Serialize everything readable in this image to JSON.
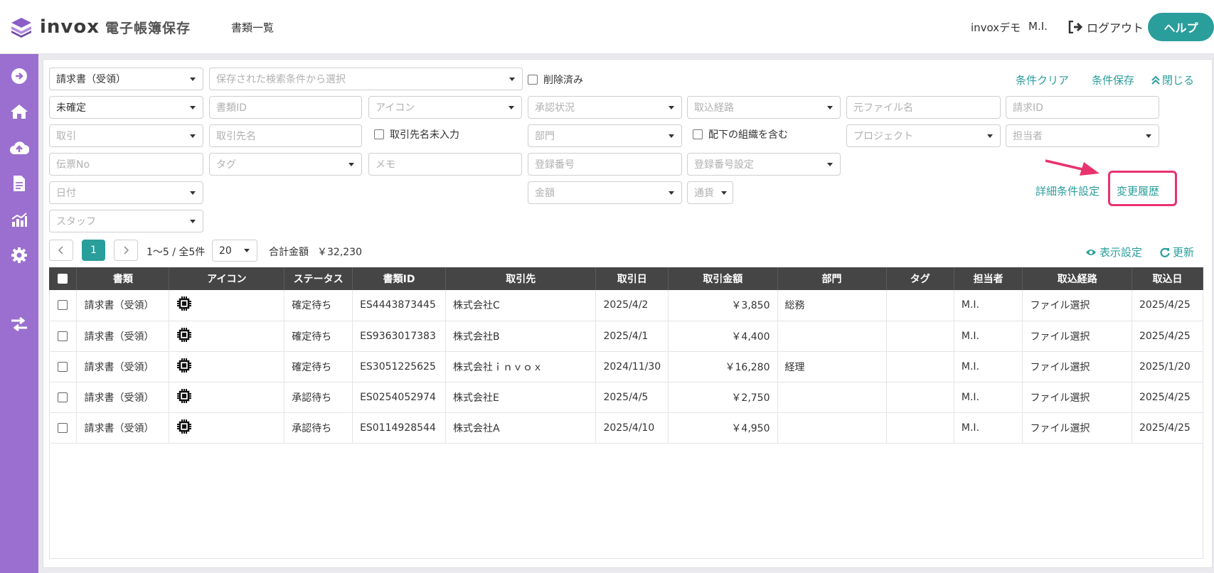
{
  "header": {
    "logo_text": "invox",
    "logo_sub": "電子帳簿保存",
    "nav_docs": "書類一覧",
    "org": "invoxデモ",
    "user": "M.I.",
    "logout": "ログアウト",
    "help": "ヘルプ"
  },
  "filters": {
    "doc_type": "請求書（受領）",
    "saved_search": "保存された検索条件から選択",
    "deleted": "削除済み",
    "clear": "条件クリア",
    "save": "条件保存",
    "close": "閉じる",
    "confirm_status": "未確定",
    "doc_id": "書類ID",
    "icon": "アイコン",
    "approval": "承認状況",
    "route": "取込経路",
    "filename": "元ファイル名",
    "invoice_id": "請求ID",
    "deal": "取引",
    "partner": "取引先名",
    "partner_blank": "取引先名未入力",
    "department": "部門",
    "include_sub": "配下の組織を含む",
    "project": "プロジェクト",
    "assignee": "担当者",
    "slip_no": "伝票No",
    "tag": "タグ",
    "memo": "メモ",
    "reg_no": "登録番号",
    "reg_no_setting": "登録番号設定",
    "detail": "詳細条件設定",
    "history": "変更履歴",
    "date": "日付",
    "amount": "金額",
    "currency": "通貨",
    "staff": "スタッフ"
  },
  "pager": {
    "current": "1",
    "range": "1〜5 / 全5件",
    "per_page": "20",
    "total_label": "合計金額",
    "total": "￥32,230",
    "display_settings": "表示設定",
    "refresh": "更新"
  },
  "table": {
    "headers": [
      "書類",
      "アイコン",
      "ステータス",
      "書類ID",
      "取引先",
      "取引日",
      "取引金額",
      "部門",
      "タグ",
      "担当者",
      "取込経路",
      "取込日"
    ],
    "rows": [
      {
        "doc": "請求書（受領）",
        "status": "確定待ち",
        "id": "ES4443873445",
        "partner": "株式会社C",
        "date": "2025/4/2",
        "amount": "￥3,850",
        "dept": "総務",
        "tag": "",
        "assignee": "M.I.",
        "route": "ファイル選択",
        "imported": "2025/4/25"
      },
      {
        "doc": "請求書（受領）",
        "status": "確定待ち",
        "id": "ES9363017383",
        "partner": "株式会社B",
        "date": "2025/4/1",
        "amount": "￥4,400",
        "dept": "",
        "tag": "",
        "assignee": "M.I.",
        "route": "ファイル選択",
        "imported": "2025/4/25"
      },
      {
        "doc": "請求書（受領）",
        "status": "確定待ち",
        "id": "ES3051225625",
        "partner": "株式会社ｉｎｖｏｘ",
        "date": "2024/11/30",
        "amount": "￥16,280",
        "dept": "経理",
        "tag": "",
        "assignee": "M.I.",
        "route": "ファイル選択",
        "imported": "2025/1/20"
      },
      {
        "doc": "請求書（受領）",
        "status": "承認待ち",
        "id": "ES0254052974",
        "partner": "株式会社E",
        "date": "2025/4/5",
        "amount": "￥2,750",
        "dept": "",
        "tag": "",
        "assignee": "M.I.",
        "route": "ファイル選択",
        "imported": "2025/4/25"
      },
      {
        "doc": "請求書（受領）",
        "status": "承認待ち",
        "id": "ES0114928544",
        "partner": "株式会社A",
        "date": "2025/4/10",
        "amount": "￥4,950",
        "dept": "",
        "tag": "",
        "assignee": "M.I.",
        "route": "ファイル選択",
        "imported": "2025/4/25"
      }
    ]
  },
  "colors": {
    "accent": "#2a9e9b",
    "sidebar": "#9a6fcf",
    "highlight": "#e8336e",
    "table_header": "#454545"
  }
}
